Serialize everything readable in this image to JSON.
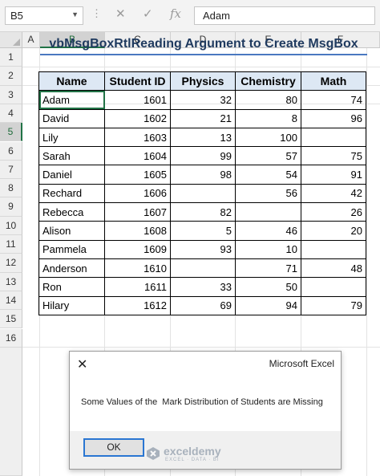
{
  "formula_bar": {
    "name_box": "B5",
    "cancel_icon": "x-icon",
    "enter_icon": "check-icon",
    "function_label": "fx",
    "formula_value": "Adam"
  },
  "sheet": {
    "column_headers": [
      "A",
      "B",
      "C",
      "D",
      "E",
      "F"
    ],
    "selected_column": "B",
    "row_headers": [
      "1",
      "2",
      "3",
      "4",
      "5",
      "6",
      "7",
      "8",
      "9",
      "10",
      "11",
      "12",
      "13",
      "14",
      "15",
      "16"
    ],
    "selected_row": "5",
    "title": "vbMsgBoxRtlReading Argument to Create MsgBox",
    "table": {
      "headers": [
        "Name",
        "Student ID",
        "Physics",
        "Chemistry",
        "Math"
      ],
      "rows": [
        [
          "Adam",
          "1601",
          "32",
          "80",
          "74"
        ],
        [
          "David",
          "1602",
          "21",
          "8",
          "96"
        ],
        [
          "Lily",
          "1603",
          "13",
          "100",
          ""
        ],
        [
          "Sarah",
          "1604",
          "99",
          "57",
          "75"
        ],
        [
          "Daniel",
          "1605",
          "98",
          "54",
          "91"
        ],
        [
          "Rechard",
          "1606",
          "",
          "56",
          "42"
        ],
        [
          "Rebecca",
          "1607",
          "82",
          "",
          "26"
        ],
        [
          "Alison",
          "1608",
          "5",
          "46",
          "20"
        ],
        [
          "Pammela",
          "1609",
          "93",
          "10",
          ""
        ],
        [
          "Anderson",
          "1610",
          "",
          "71",
          "48"
        ],
        [
          "Ron",
          "1611",
          "33",
          "50",
          ""
        ],
        [
          "Hilary",
          "1612",
          "69",
          "94",
          "79"
        ]
      ]
    }
  },
  "dialog": {
    "title": "Microsoft Excel",
    "message": "Some Values of the  Mark Distribution of Students are Missing",
    "ok_label": "OK",
    "close_icon": "close-icon"
  },
  "watermark": {
    "name": "exceldemy",
    "tagline": "EXCEL · DATA · BI"
  },
  "colors": {
    "accent": "#217346",
    "header_fill": "#dde8f4",
    "title_color": "#1f3a5f",
    "button_focus": "#2a76d2"
  }
}
